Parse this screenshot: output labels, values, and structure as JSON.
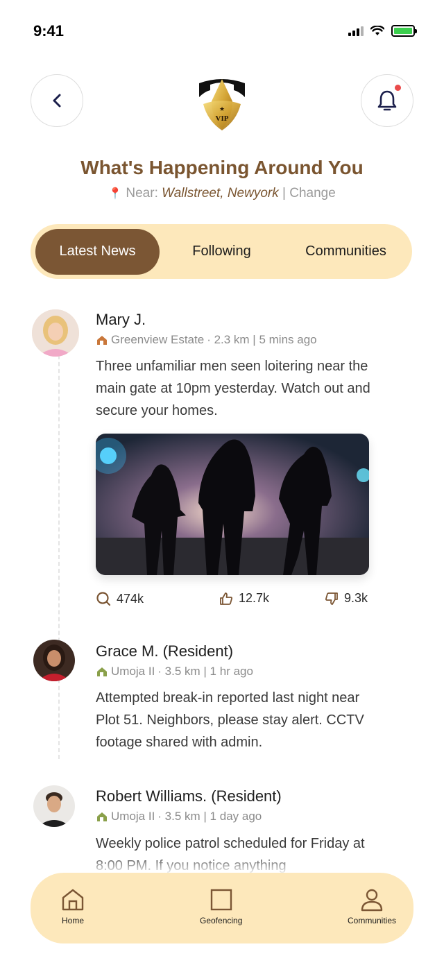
{
  "status_bar": {
    "time": "9:41"
  },
  "header": {
    "title": "What's Happening Around You",
    "location_prefix": "Near:",
    "location": "Wallstreet, Newyork",
    "separator": "|",
    "change_label": "Change",
    "logo_text": "VIP"
  },
  "tabs": [
    {
      "label": "Latest News",
      "active": true
    },
    {
      "label": "Following",
      "active": false
    },
    {
      "label": "Communities",
      "active": false
    }
  ],
  "posts": [
    {
      "author": "Mary J.",
      "community": "Greenview Estate",
      "meta": "· 2.3 km | 5 mins ago",
      "text": "Three unfamiliar men seen loitering near the main gate at 10pm yesterday. Watch out and secure your homes.",
      "stats": {
        "views": "474k",
        "likes": "12.7k",
        "dislikes": "9.3k"
      }
    },
    {
      "author": "Grace M. (Resident)",
      "community": "Umoja II",
      "meta": "· 3.5 km | 1 hr ago",
      "text": "Attempted break-in reported last night near Plot 51. Neighbors, please stay alert. CCTV footage shared with admin."
    },
    {
      "author": "Robert Williams. (Resident)",
      "community": "Umoja II",
      "meta": "· 3.5 km | 1 day ago",
      "text": "Weekly police patrol scheduled for Friday at 8:00 PM. If you notice anything"
    }
  ],
  "bottom_nav": [
    {
      "label": "Home",
      "icon": "home-icon"
    },
    {
      "label": "Geofencing",
      "icon": "square-icon"
    },
    {
      "label": "Communities",
      "icon": "user-icon"
    }
  ],
  "colors": {
    "brand_brown": "#7b5634",
    "title_brown": "#7a5530",
    "cream": "#fde8bb",
    "alert_red": "#ea4b4b"
  }
}
